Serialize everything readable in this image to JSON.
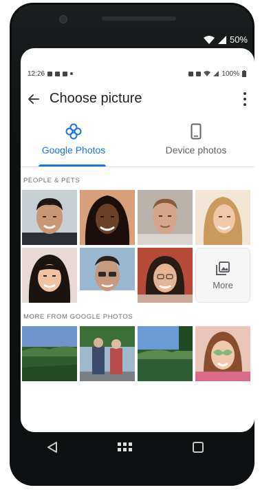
{
  "device": {
    "battery": "50%"
  },
  "status_bar": {
    "time": "12:26",
    "battery": "100%"
  },
  "app_bar": {
    "title": "Choose picture"
  },
  "tabs": [
    {
      "label": "Google Photos",
      "icon": "pinwheel-icon",
      "selected": true
    },
    {
      "label": "Device photos",
      "icon": "phone-icon",
      "selected": false
    }
  ],
  "sections": {
    "people": "PEOPLE & PETS",
    "more_from": "MORE FROM GOOGLE PHOTOS"
  },
  "more_button": {
    "label": "More"
  },
  "colors": {
    "accent": "#1a73e8"
  }
}
